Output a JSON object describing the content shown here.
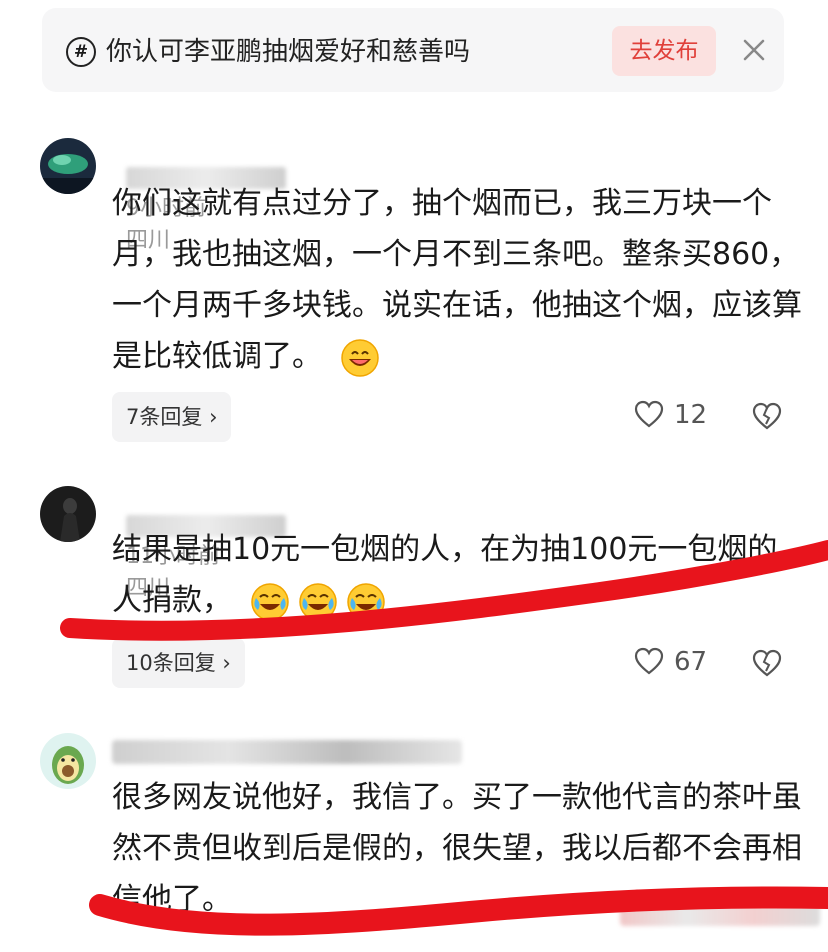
{
  "topic": {
    "hashtag": "#",
    "text": "你认可李亚鹏抽烟爱好和慈善吗",
    "publish_label": "去发布",
    "close_icon": "close-icon"
  },
  "comments": [
    {
      "time": "9小时前",
      "location": "四川",
      "text": "你们这就有点过分了，抽个烟而已，我三万块一个月，我也抽这烟，一个月不到三条吧。整条买860，一个月两千多块钱。说实在话，他抽这个烟，应该算是比较低调了。",
      "emoji": "grinning-face-emoji",
      "replies_label": "7条回复",
      "likes": "12"
    },
    {
      "time": "11小时前",
      "location": "四川",
      "text": "结果是抽10元一包烟的人，在为抽100元一包烟的人捐款，",
      "emoji": "tears-of-joy-emoji",
      "replies_label": "10条回复",
      "likes": "67"
    },
    {
      "text": "很多网友说他好，我信了。买了一款他代言的茶叶虽然不贵但收到后是假的，很失望，我以后都不会再相信他了。",
      "emoji": "none"
    }
  ],
  "colors": {
    "accent_red": "#e0403a",
    "publish_bg": "#fbe1e0",
    "annotation_red": "#e8141c",
    "meta_gray": "#9a9a9a"
  }
}
